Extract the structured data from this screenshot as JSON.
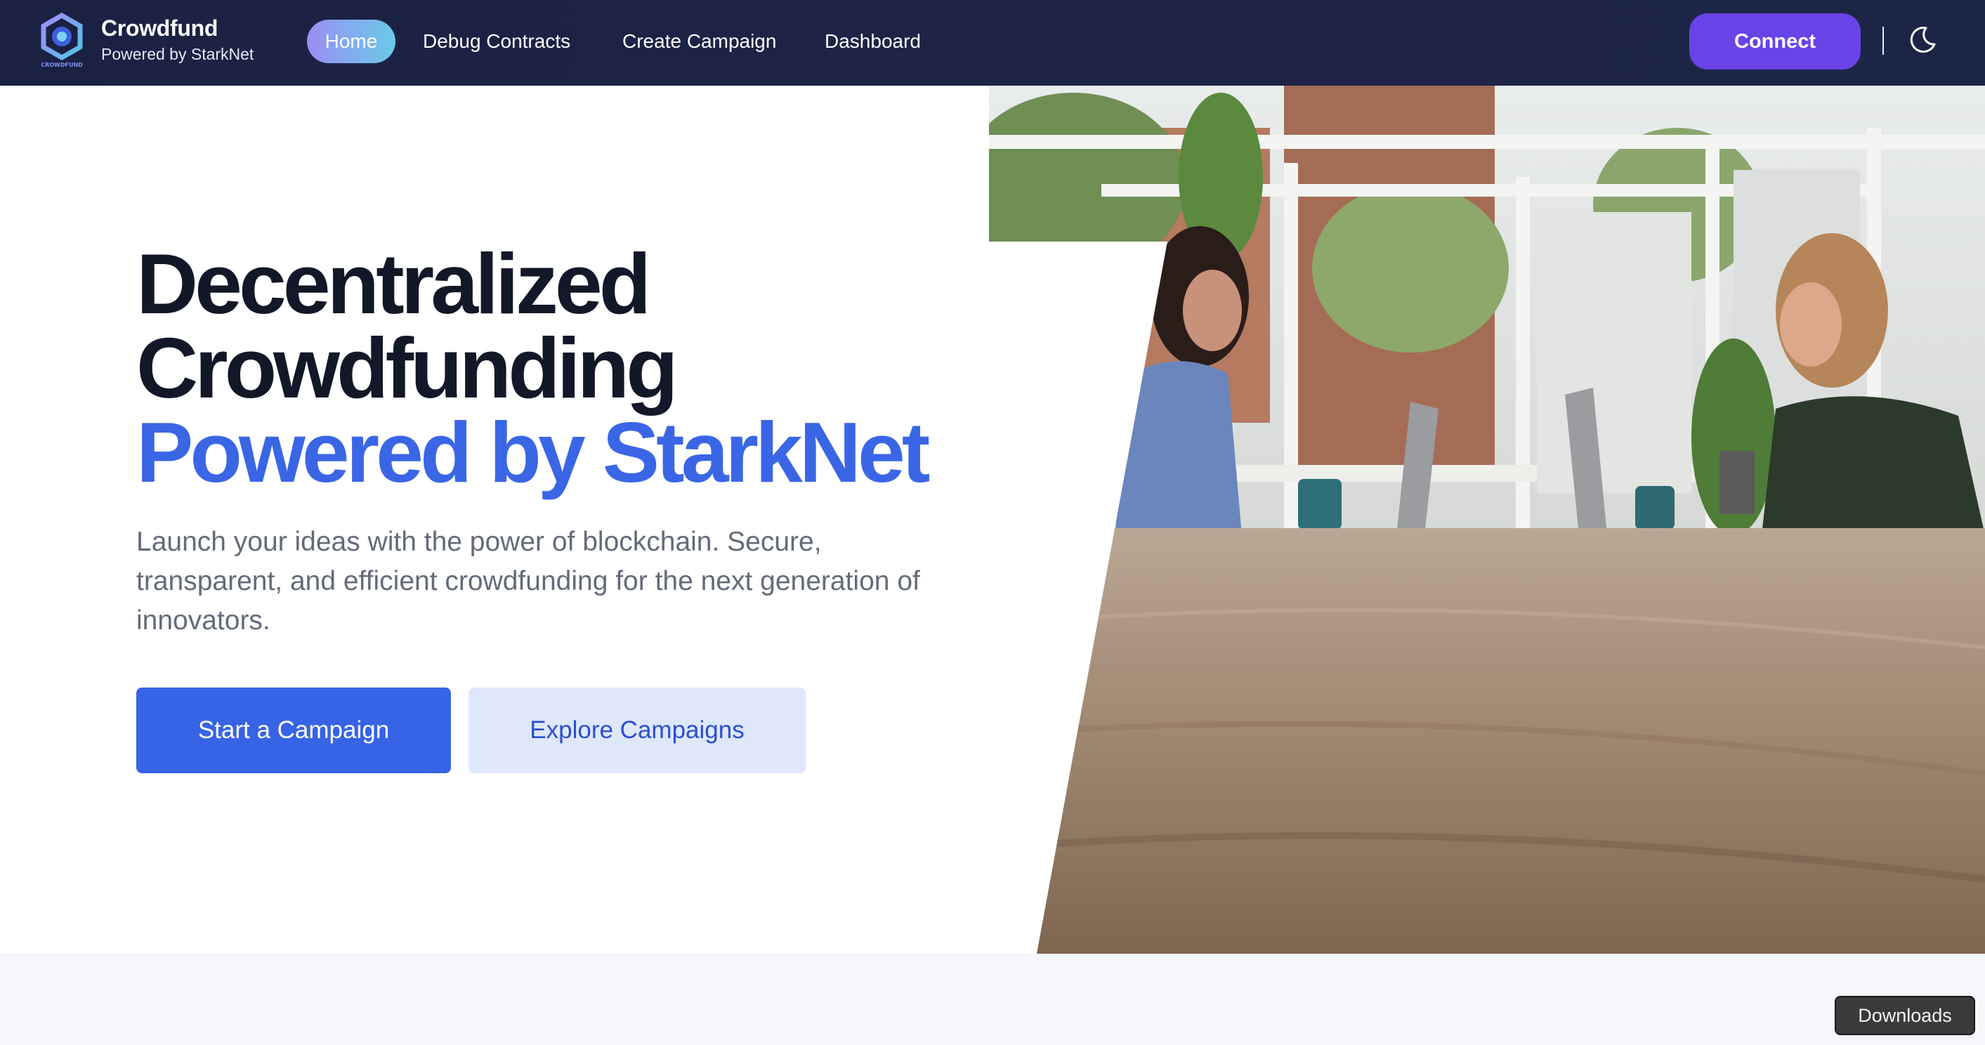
{
  "brand": {
    "title": "Crowdfund",
    "subtitle": "Powered by StarkNet",
    "logo_text": "CROWDFUND",
    "logo_icon": "hexagon-ring-logo"
  },
  "nav": {
    "items": [
      {
        "label": "Home",
        "active": true
      },
      {
        "label": "Debug Contracts",
        "active": false
      },
      {
        "label": "Create Campaign",
        "active": false
      },
      {
        "label": "Dashboard",
        "active": false
      }
    ],
    "connect_label": "Connect",
    "theme_icon": "moon-icon"
  },
  "hero": {
    "title_line1": "Decentralized",
    "title_line2": "Crowdfunding",
    "title_line3": "Powered by StarkNet",
    "description": "Launch your ideas with the power of blockchain. Secure, transparent, and efficient crowdfunding for the next generation of innovators.",
    "primary_cta": "Start a Campaign",
    "secondary_cta": "Explore Campaigns",
    "image_subject": "two people working on laptops at a wooden table"
  },
  "overlay": {
    "downloads_label": "Downloads"
  },
  "colors": {
    "navbar_bg": "#1b2143",
    "accent_blue": "#3a66e6",
    "connect_purple": "#6843e7",
    "heading_dark": "#121828",
    "body_gray": "#636b7a",
    "secondary_btn_bg": "#dfe7fb"
  }
}
